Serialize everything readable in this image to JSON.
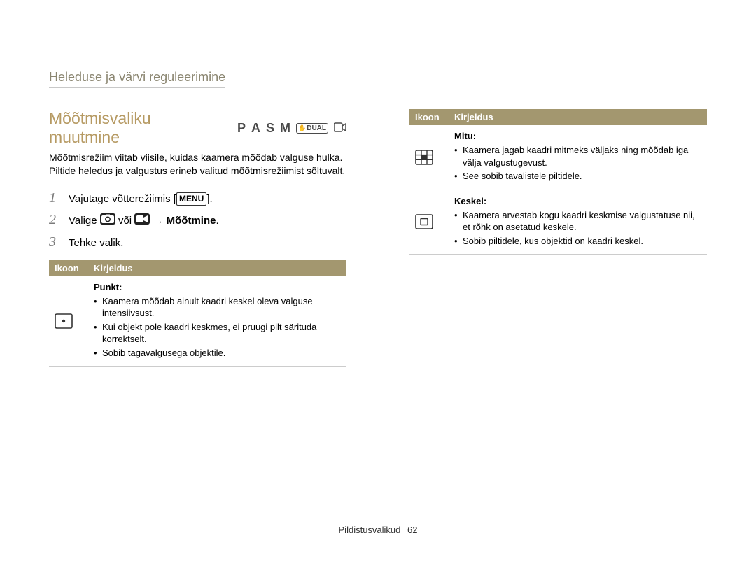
{
  "breadcrumb": "Heleduse ja värvi reguleerimine",
  "section_title": "Mõõtmisvaliku muutmine",
  "modes": {
    "p": "P",
    "a": "A",
    "s": "S",
    "m": "M",
    "dual": "DUAL"
  },
  "intro": "Mõõtmisrežiim viitab viisile, kuidas kaamera mõõdab valguse hulka. Piltide heledus ja valgustus erineb valitud mõõtmisrežiimist sõltuvalt.",
  "steps": {
    "s1_num": "1",
    "s1_a": "Vajutage võtterežiimis [",
    "s1_menu": "MENU",
    "s1_b": "].",
    "s2_num": "2",
    "s2_a": "Valige ",
    "s2_b": " või ",
    "s2_c": " → ",
    "s2_target": "Mõõtmine",
    "s2_d": ".",
    "s3_num": "3",
    "s3_a": "Tehke valik."
  },
  "table_headers": {
    "icon": "Ikoon",
    "desc": "Kirjeldus"
  },
  "left_table": {
    "row1": {
      "title": "Punkt:",
      "b1": "Kaamera mõõdab ainult kaadri keskel oleva valguse intensiivsust.",
      "b2": "Kui objekt pole kaadri keskmes, ei pruugi pilt särituda korrektselt.",
      "b3": "Sobib tagavalgusega objektile."
    }
  },
  "right_table": {
    "row1": {
      "title": "Mitu:",
      "b1": "Kaamera jagab kaadri mitmeks väljaks ning mõõdab iga välja valgustugevust.",
      "b2": "See sobib tavalistele piltidele."
    },
    "row2": {
      "title": "Keskel:",
      "b1": "Kaamera arvestab kogu kaadri keskmise valgustatuse nii, et rõhk on asetatud keskele.",
      "b2": "Sobib piltidele, kus objektid on kaadri keskel."
    }
  },
  "footer": {
    "section": "Pildistusvalikud",
    "page": "62"
  }
}
